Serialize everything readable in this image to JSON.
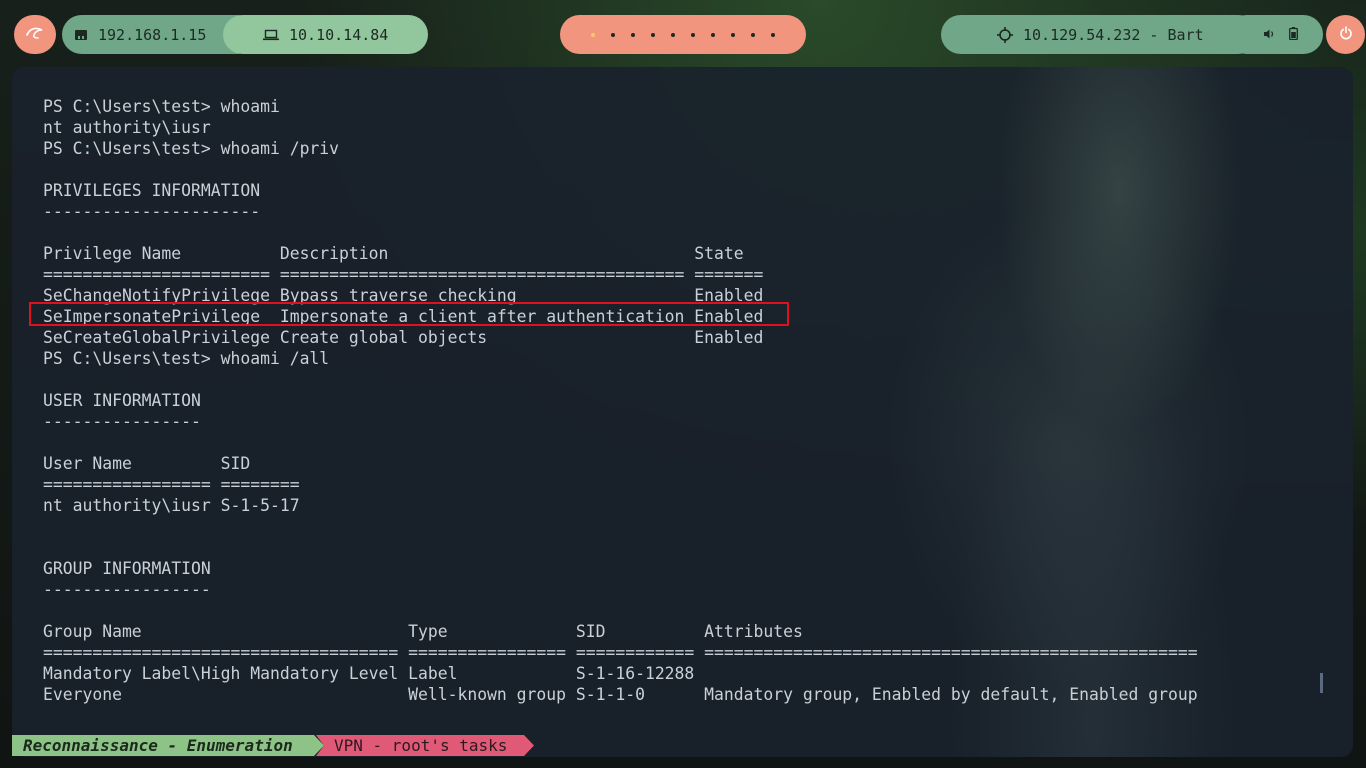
{
  "topbar": {
    "start_icon": "kali-dragon-icon",
    "local_ip": {
      "icon": "ethernet-icon",
      "label": "192.168.1.15"
    },
    "vpn_ip": {
      "icon": "laptop-icon",
      "label": "10.10.14.84"
    },
    "workspaces": {
      "count": 10,
      "active_index": 0
    },
    "target": {
      "icon": "crosshair-icon",
      "label": "10.129.54.232 - Bart"
    },
    "system_icons": [
      "volume-icon",
      "battery-icon"
    ],
    "power_icon": "power-icon"
  },
  "terminal": {
    "lines": [
      "PS C:\\Users\\test> whoami",
      "nt authority\\iusr",
      "PS C:\\Users\\test> whoami /priv",
      "",
      "PRIVILEGES INFORMATION",
      "----------------------",
      "",
      "Privilege Name          Description                               State",
      "======================= ========================================= =======",
      "SeChangeNotifyPrivilege Bypass traverse checking                  Enabled",
      "SeImpersonatePrivilege  Impersonate a client after authentication Enabled",
      "SeCreateGlobalPrivilege Create global objects                     Enabled",
      "PS C:\\Users\\test> whoami /all",
      "",
      "USER INFORMATION",
      "----------------",
      "",
      "User Name         SID",
      "================= ========",
      "nt authority\\iusr S-1-5-17",
      "",
      "",
      "GROUP INFORMATION",
      "-----------------",
      "",
      "Group Name                           Type             SID          Attributes",
      "==================================== ================ ============ ==================================================",
      "Mandatory Label\\High Mandatory Level Label            S-1-16-12288",
      "Everyone                             Well-known group S-1-1-0      Mandatory group, Enabled by default, Enabled group"
    ],
    "highlight_color": "#e01020"
  },
  "tabs": [
    {
      "label": "Reconnaissance - Enumeration",
      "active": true,
      "color": "#8ec387"
    },
    {
      "label": "VPN - root's tasks",
      "active": false,
      "color": "#e05a78"
    }
  ]
}
